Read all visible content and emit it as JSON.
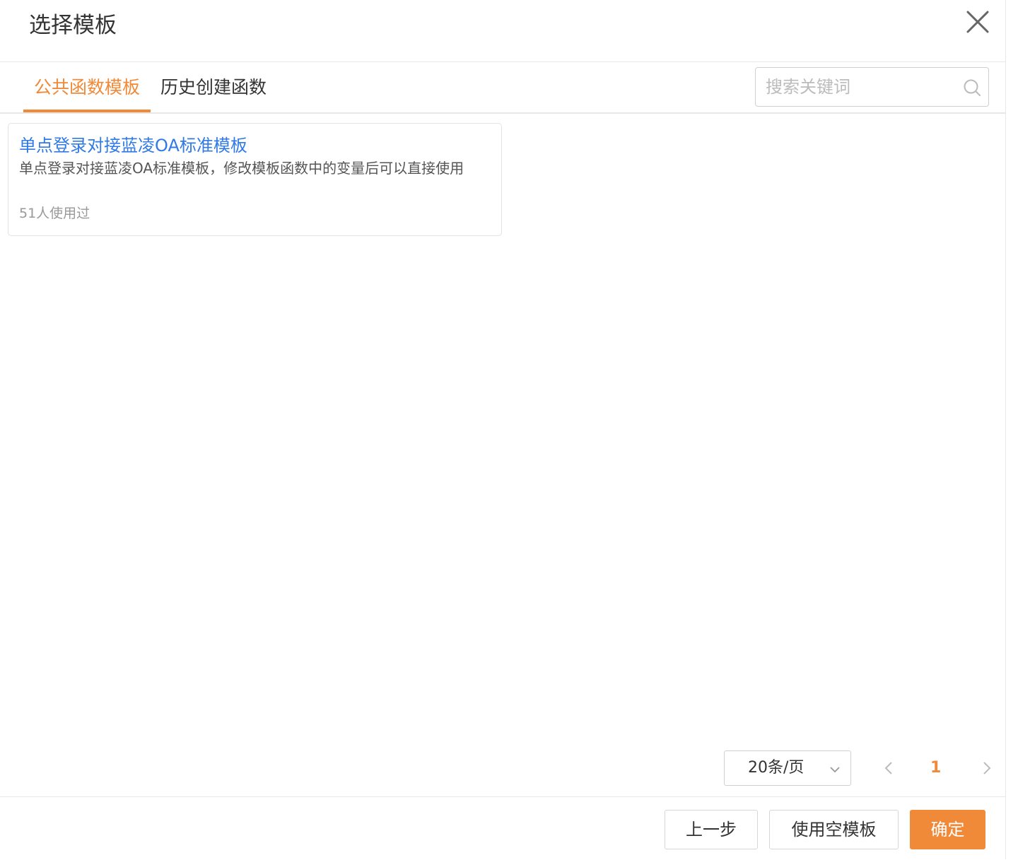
{
  "dialog": {
    "title": "选择模板"
  },
  "tabs": [
    {
      "label": "公共函数模板",
      "active": true
    },
    {
      "label": "历史创建函数",
      "active": false
    }
  ],
  "search": {
    "placeholder": "搜索关键词",
    "value": ""
  },
  "templates": [
    {
      "title": "单点登录对接蓝凌OA标准模板",
      "description": "单点登录对接蓝凌OA标准模板，修改模板函数中的变量后可以直接使用",
      "usage": "51人使用过"
    }
  ],
  "pagination": {
    "page_size": "20条/页",
    "current_page": "1"
  },
  "footer": {
    "prev_label": "上一步",
    "blank_label": "使用空模板",
    "ok_label": "确定"
  },
  "colors": {
    "accent": "#f08a38",
    "link": "#2f7ae5",
    "text": "#333333",
    "muted": "#999999",
    "border": "#e8e8e8"
  },
  "icons": {
    "close": "close-icon",
    "search": "search-icon",
    "dropdown": "chevron-down-icon",
    "prev": "chevron-left-icon",
    "next": "chevron-right-icon"
  }
}
